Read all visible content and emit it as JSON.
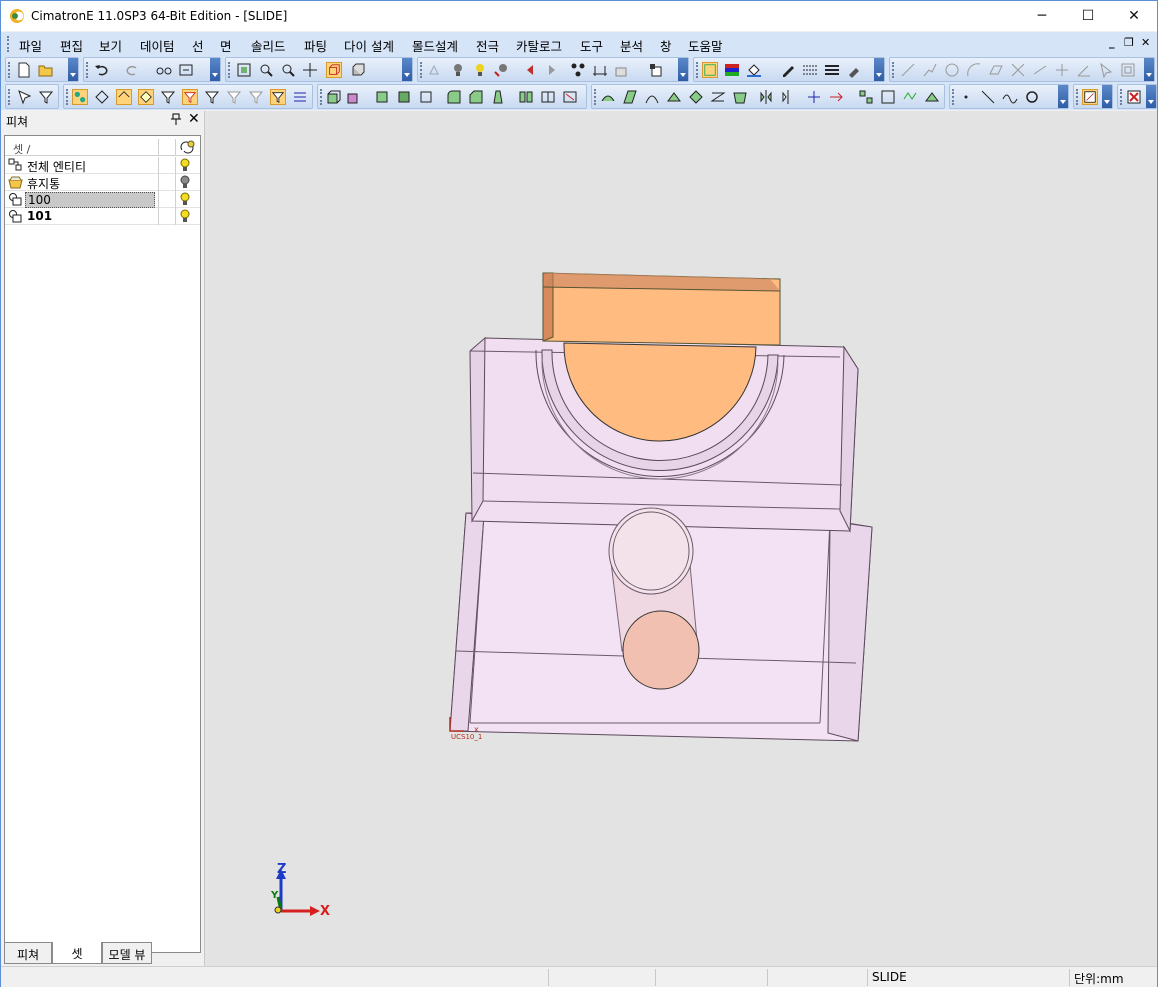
{
  "window": {
    "title": "CimatronE 11.0SP3 64-Bit Edition - [SLIDE]",
    "controls": {
      "minimize": "─",
      "maximize": "☐",
      "close": "✕"
    }
  },
  "menubar": {
    "items": [
      "파일",
      "편집",
      "보기",
      "데이텀",
      "선",
      "면",
      "솔리드",
      "파팅",
      "다이 설계",
      "몰드설계",
      "전극",
      "카탈로그",
      "도구",
      "분석",
      "창",
      "도움말"
    ],
    "mdi_controls": {
      "minimize": "_",
      "restore": "❐",
      "close": "✕"
    }
  },
  "panel": {
    "title": "피쳐",
    "pin": "ₚ",
    "close": "✕",
    "column_header": "셋 /",
    "rows": [
      {
        "label": "전체 엔티티",
        "icon": "all-entities-icon",
        "bulb": "on"
      },
      {
        "label": "휴지통",
        "icon": "trash-bin-icon",
        "bulb": "off"
      },
      {
        "label": "100",
        "icon": "set-icon",
        "bulb": "on"
      },
      {
        "label": "101",
        "icon": "set-icon",
        "bulb": "on"
      }
    ],
    "tabs": [
      "피쳐",
      "셋",
      "모델 뷰"
    ]
  },
  "viewport": {
    "ucs_label": "UCS10_1",
    "triad": {
      "z": "Z",
      "y": "Y",
      "x": "X"
    },
    "colors": {
      "background": "#e3e3e3",
      "solid_orange": "#ffbb80",
      "transparent_body": "#f3e3f3",
      "edge": "#5a4a5a"
    }
  },
  "statusbar": {
    "mode": "SLIDE",
    "units": "단위:mm"
  }
}
